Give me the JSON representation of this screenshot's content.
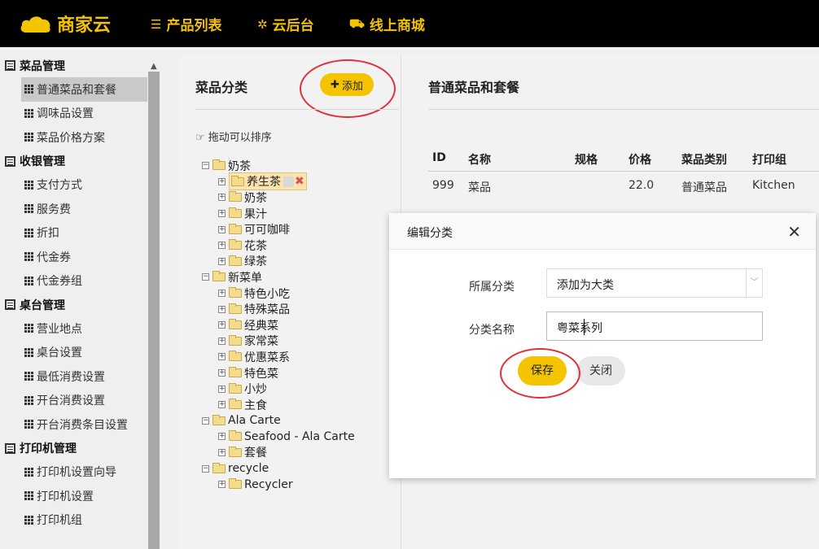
{
  "header": {
    "brand": "商家云",
    "nav": [
      {
        "label": "产品列表",
        "icon": "list-icon"
      },
      {
        "label": "云后台",
        "icon": "gear-icon"
      },
      {
        "label": "线上商城",
        "icon": "cart-icon"
      }
    ],
    "brand_color": "#f5c400"
  },
  "sidebar": {
    "groups": [
      {
        "label": "菜品管理",
        "items": [
          "普通菜品和套餐",
          "调味品设置",
          "菜品价格方案"
        ]
      },
      {
        "label": "收银管理",
        "items": [
          "支付方式",
          "服务费",
          "折扣",
          "代金券",
          "代金券组"
        ]
      },
      {
        "label": "桌台管理",
        "items": [
          "营业地点",
          "桌台设置",
          "最低消费设置",
          "开台消费设置",
          "开台消费条目设置"
        ]
      },
      {
        "label": "打印机管理",
        "items": [
          "打印机设置向导",
          "打印机设置",
          "打印机组"
        ]
      }
    ],
    "active_item": "普通菜品和套餐"
  },
  "category_panel": {
    "title": "菜品分类",
    "add_label": "添加",
    "drag_hint": "拖动可以排序",
    "tree": [
      {
        "label": "奶茶",
        "children": [
          "养生茶",
          "奶茶",
          "果汁",
          "可可咖啡",
          "花茶",
          "绿茶"
        ]
      },
      {
        "label": "新菜单",
        "children": [
          "特色小吃",
          "特殊菜品",
          "经典菜",
          "家常菜",
          "优惠菜系",
          "特色菜",
          "小炒",
          "主食"
        ]
      },
      {
        "label": "Ala Carte",
        "children": [
          "Seafood - Ala Carte",
          "套餐"
        ]
      },
      {
        "label": "recycle",
        "children": [
          "Recycler"
        ]
      }
    ],
    "selected_node": "养生茶"
  },
  "main": {
    "title": "普通菜品和套餐",
    "columns": [
      "ID",
      "名称",
      "规格",
      "价格",
      "菜品类别",
      "打印组"
    ],
    "rows": [
      [
        "999",
        "菜品",
        "",
        "22.0",
        "普通菜品",
        "Kitchen"
      ]
    ]
  },
  "modal": {
    "title": "编辑分类",
    "parent_label": "所属分类",
    "parent_value": "添加为大类",
    "name_label": "分类名称",
    "name_value": "粤菜系列",
    "save_label": "保存",
    "cancel_label": "关闭"
  }
}
